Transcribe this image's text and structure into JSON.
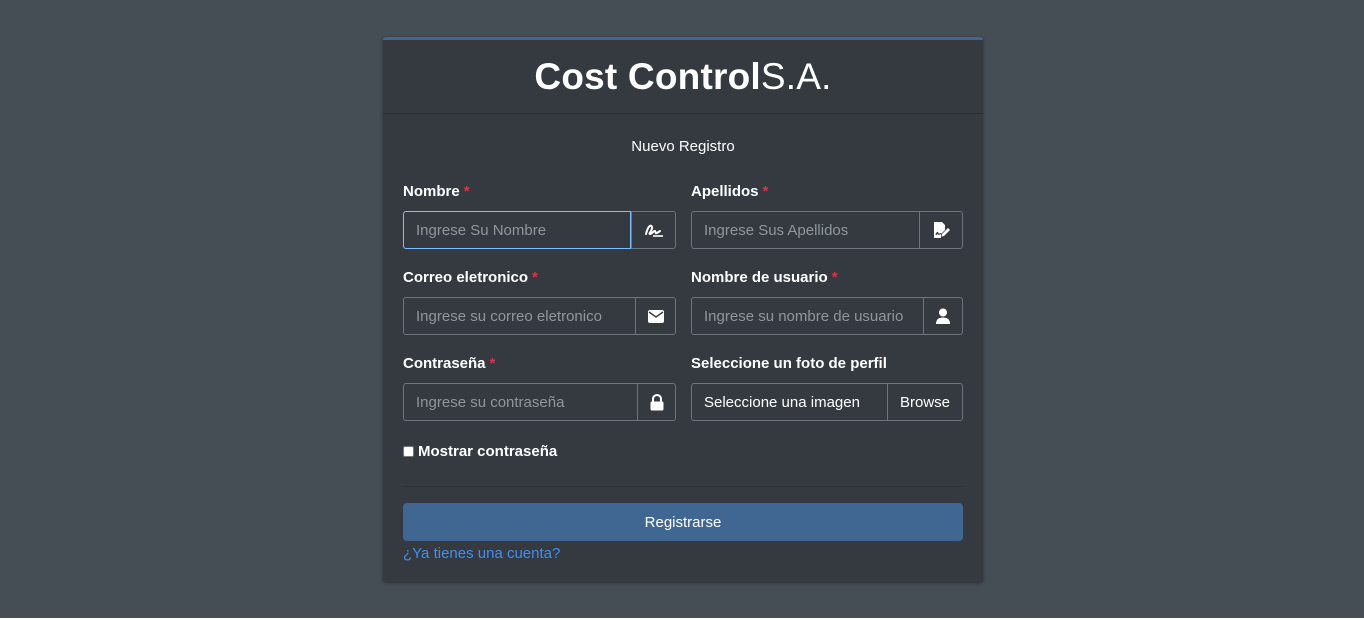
{
  "brand": {
    "bold": "Cost Control",
    "suffix": "S.A."
  },
  "form": {
    "subtitle": "Nuevo Registro",
    "required_mark": "*",
    "fields": {
      "nombre": {
        "label": "Nombre",
        "placeholder": "Ingrese Su Nombre",
        "icon": "signature-icon"
      },
      "apellidos": {
        "label": "Apellidos",
        "placeholder": "Ingrese Sus Apellidos",
        "icon": "file-signature-icon"
      },
      "correo": {
        "label": "Correo eletronico",
        "placeholder": "Ingrese su correo eletronico",
        "icon": "envelope-icon"
      },
      "usuario": {
        "label": "Nombre de usuario",
        "placeholder": "Ingrese su nombre de usuario",
        "icon": "user-icon"
      },
      "contrasena": {
        "label": "Contraseña",
        "placeholder": "Ingrese su contraseña",
        "icon": "lock-icon"
      },
      "foto": {
        "label": "Seleccione un foto de perfil",
        "value": "Seleccione una imagen",
        "button": "Browse"
      }
    },
    "show_password": {
      "label": "Mostrar contraseña",
      "checked": false
    },
    "submit": "Registrarse",
    "login_link": "¿Ya tienes una cuenta?"
  },
  "colors": {
    "background": "#454d55",
    "card": "#343a40",
    "accent": "#3f6791",
    "required": "#dc3545",
    "link": "#3f8ff5"
  }
}
